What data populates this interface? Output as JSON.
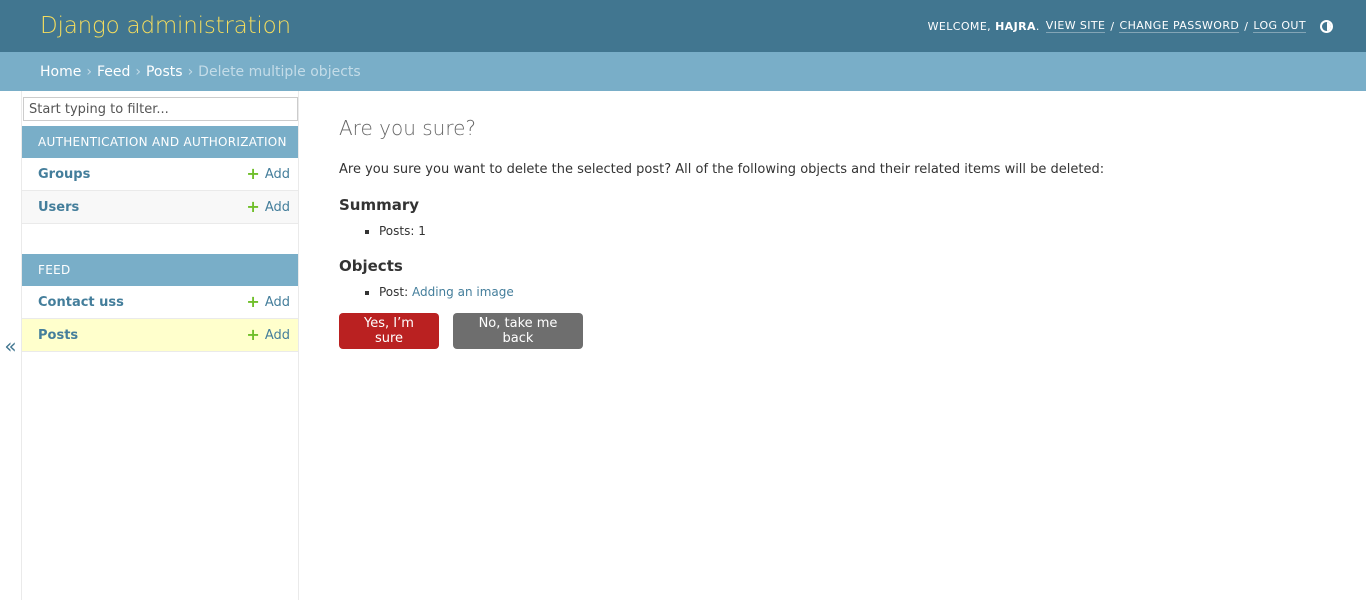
{
  "header": {
    "branding": "Django administration",
    "welcome_prefix": "Welcome,",
    "username": "hajra",
    "view_site": "View site",
    "change_password": "Change password",
    "log_out": "Log out"
  },
  "breadcrumbs": {
    "home": "Home",
    "app": "Feed",
    "model": "Posts",
    "current": "Delete multiple objects",
    "separator": "›"
  },
  "sidebar": {
    "toggle": "«",
    "filter_placeholder": "Start typing to filter...",
    "add_label": "Add",
    "modules": [
      {
        "caption": "Authentication and Authorization",
        "models": [
          "Groups",
          "Users"
        ]
      },
      {
        "caption": "Feed",
        "models": [
          "Contact uss",
          "Posts"
        ]
      }
    ]
  },
  "content": {
    "title": "Are you sure?",
    "intro": "Are you sure you want to delete the selected post? All of the following objects and their related items will be deleted:",
    "summary_heading": "Summary",
    "summary_item": "Posts: 1",
    "objects_heading": "Objects",
    "object_prefix": "Post:",
    "object_link": "Adding an image",
    "confirm_button": "Yes, I’m sure",
    "cancel_button": "No, take me back"
  },
  "colors": {
    "header_bg": "#417690",
    "branding": "#f5dd5d",
    "breadcrumbs_bg": "#79aec8",
    "link": "#447e9b",
    "danger": "#ba2121",
    "cancel": "#6e6e6e",
    "current_row": "#ffffcc",
    "add_icon": "#70bf2b"
  }
}
